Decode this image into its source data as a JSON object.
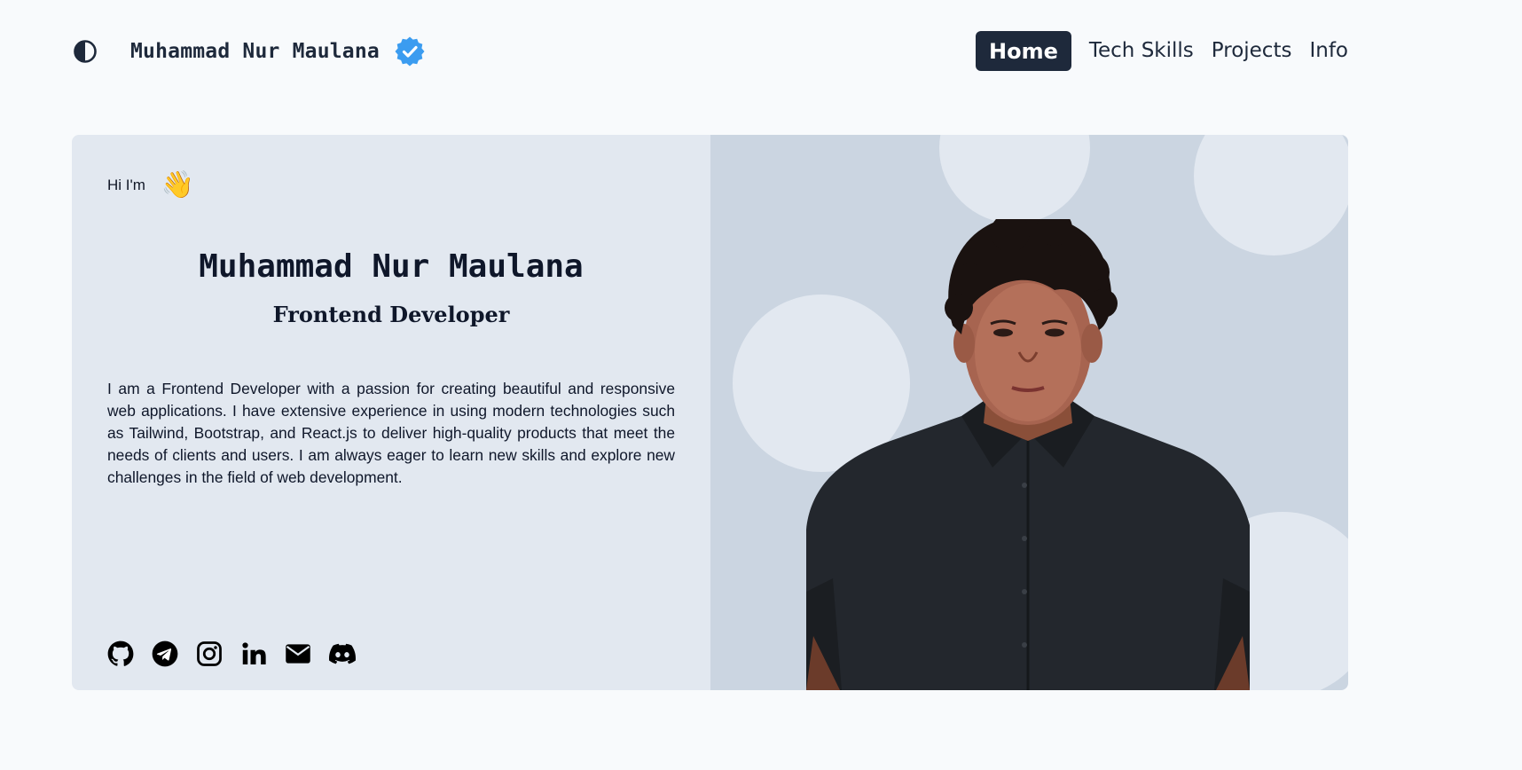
{
  "header": {
    "brand_name": "Muhammad Nur Maulana",
    "nav": [
      {
        "label": "Home",
        "active": true
      },
      {
        "label": "Tech Skills",
        "active": false
      },
      {
        "label": "Projects",
        "active": false
      },
      {
        "label": "Info",
        "active": false
      }
    ]
  },
  "hero": {
    "greeting": "Hi I'm",
    "greeting_emoji": "👋",
    "name": "Muhammad Nur Maulana",
    "role": "Frontend Developer",
    "bio": "I am a Frontend Developer with a passion for creating beautiful and responsive web applications. I have extensive experience in using modern technologies such as Tailwind, Bootstrap, and React.js to deliver high-quality products that meet the needs of clients and users. I am always eager to learn new skills and explore new challenges in the field of web development.",
    "socials": [
      "github-icon",
      "telegram-icon",
      "instagram-icon",
      "linkedin-icon",
      "email-icon",
      "discord-icon"
    ]
  },
  "colors": {
    "page_bg": "#f8fafc",
    "text": "#1e293b",
    "nav_active_bg": "#1e293b",
    "card_left_bg": "#e2e8f0",
    "card_right_bg": "#cbd5e1",
    "verified_badge": "#3b9cf0"
  }
}
